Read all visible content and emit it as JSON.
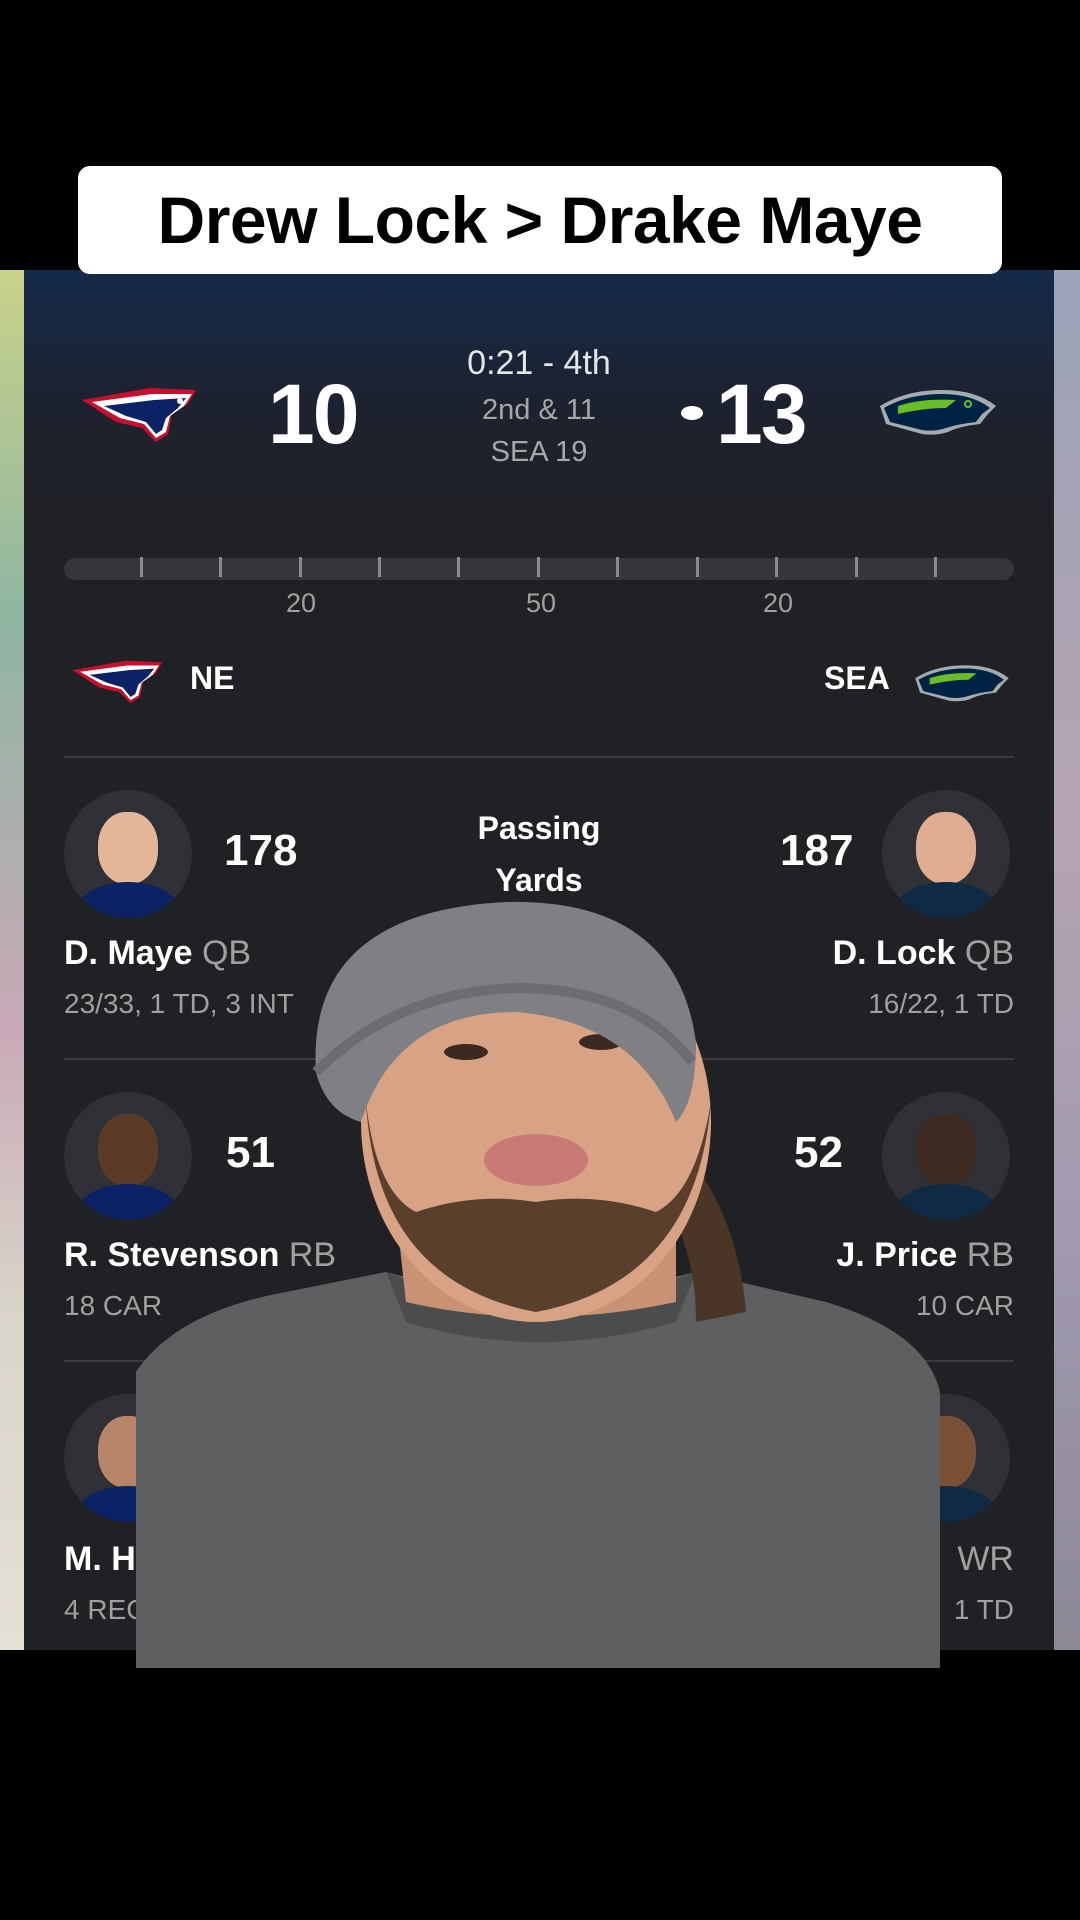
{
  "caption": "Drew Lock > Drake Maye",
  "game": {
    "home_score": "10",
    "away_score": "13",
    "clock": "0:21 - 4th",
    "down": "2nd & 11",
    "spot": "SEA 19",
    "colors": {
      "panel": "#202124",
      "patriots_red": "#c8102e",
      "patriots_navy": "#0b2265",
      "seahawks_navy": "#002244",
      "seahawks_green": "#69be28"
    }
  },
  "field": {
    "markers": [
      "20",
      "50",
      "20"
    ]
  },
  "teams": {
    "left": "NE",
    "right": "SEA"
  },
  "leaders": [
    {
      "category_line1": "Passing",
      "category_line2": "Yards",
      "left": {
        "value": "178",
        "name": "D. Maye",
        "pos": "QB",
        "line": "23/33, 1 TD, 3 INT"
      },
      "right": {
        "value": "187",
        "name": "D. Lock",
        "pos": "QB",
        "line": "16/22, 1 TD"
      }
    },
    {
      "left": {
        "value": "51",
        "name": "R. Stevenson",
        "pos": "RB",
        "line": "18 CAR"
      },
      "right": {
        "value": "52",
        "name": "J. Price",
        "pos": "RB",
        "line": "10 CAR"
      }
    },
    {
      "left": {
        "name": "M. H",
        "line": "4 REC"
      },
      "right": {
        "pos": "WR",
        "line": "1 TD"
      }
    }
  ],
  "icons": [
    "patriots-logo-icon",
    "seahawks-logo-icon",
    "possession-dot-icon"
  ]
}
